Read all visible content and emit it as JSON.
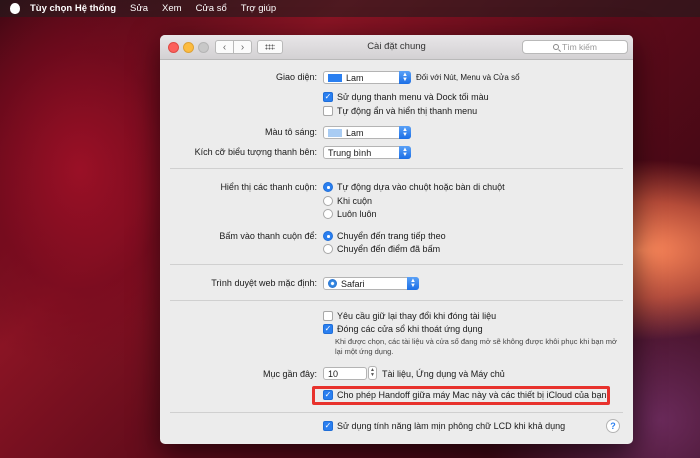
{
  "menubar": {
    "app_name": "Tùy chọn Hệ thống",
    "items": [
      "Sửa",
      "Xem",
      "Cửa sổ",
      "Trợ giúp"
    ]
  },
  "window": {
    "title": "Cài đặt chung",
    "search_placeholder": "Tìm kiếm"
  },
  "appearance": {
    "label": "Giao diện:",
    "value": "Lam",
    "note": "Đối với Nút, Menu và Cửa sổ",
    "swatch_color": "#2a7ff0",
    "dark_menu": {
      "label": "Sử dụng thanh menu và Dock tối màu",
      "checked": true
    },
    "autohide_menu": {
      "label": "Tự động ẩn và hiển thị thanh menu",
      "checked": false
    }
  },
  "highlight": {
    "label": "Màu tô sáng:",
    "value": "Lam",
    "swatch_color": "#a9ccf3"
  },
  "sidebar_icon_size": {
    "label": "Kích cỡ biểu tượng thanh bên:",
    "value": "Trung bình"
  },
  "scroll_bars": {
    "label": "Hiển thị các thanh cuộn:",
    "options": [
      {
        "label": "Tự động dựa vào chuột hoặc bàn di chuột",
        "selected": true
      },
      {
        "label": "Khi cuộn",
        "selected": false
      },
      {
        "label": "Luôn luôn",
        "selected": false
      }
    ]
  },
  "scroll_click": {
    "label": "Bấm vào thanh cuộn để:",
    "options": [
      {
        "label": "Chuyển đến trang tiếp theo",
        "selected": true
      },
      {
        "label": "Chuyển đến điểm đã bấm",
        "selected": false
      }
    ]
  },
  "browser": {
    "label": "Trình duyệt web mặc định:",
    "value": "Safari"
  },
  "documents": {
    "ask_keep": {
      "label": "Yêu cầu giữ lại thay đổi khi đóng tài liệu",
      "checked": false
    },
    "close_windows": {
      "label": "Đóng các cửa sổ khi thoát ứng dụng",
      "checked": true
    },
    "note": "Khi được chọn, các tài liệu và cửa sổ đang mở sẽ không được khôi phục khi bạn mở lại một ứng dụng."
  },
  "recent": {
    "label": "Mục gần đây:",
    "value": "10",
    "suffix": "Tài liệu, Ứng dụng và Máy chủ"
  },
  "handoff": {
    "label": "Cho phép Handoff giữa máy Mac này và các thiết bị iCloud của bạn",
    "checked": true
  },
  "lcd": {
    "label": "Sử dụng tính năng làm mịn phông chữ LCD khi khả dụng",
    "checked": true
  },
  "help": {
    "label": "?"
  }
}
